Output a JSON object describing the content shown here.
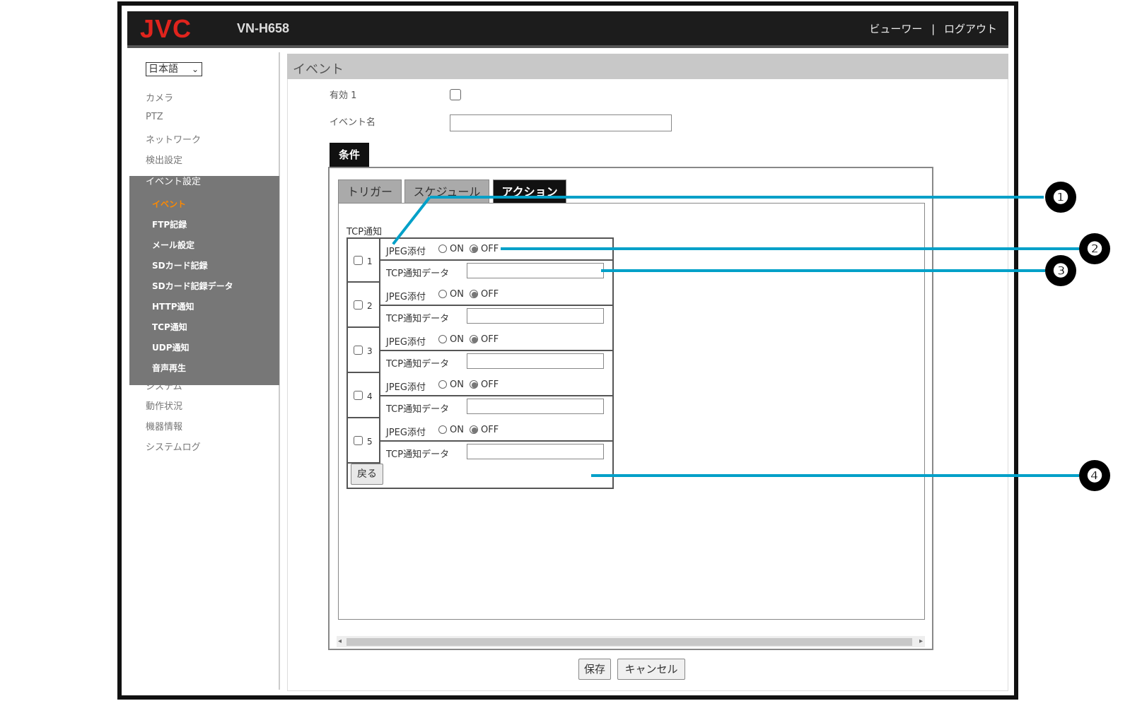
{
  "header": {
    "logo": "JVC",
    "model": "VN-H658",
    "viewer_link": "ビューワー",
    "separator": "|",
    "logout_link": "ログアウト"
  },
  "sidebar": {
    "language": "日本語",
    "items_top": [
      "カメラ",
      "PTZ",
      "ネットワーク",
      "検出設定"
    ],
    "group_title": "イベント設定",
    "sub_items": [
      "イベント",
      "FTP記録",
      "メール設定",
      "SDカード記録",
      "SDカード記録データ",
      "HTTP通知",
      "TCP通知",
      "UDP通知",
      "音声再生"
    ],
    "items_bottom": [
      "システム",
      "動作状況",
      "機器情報",
      "システムログ"
    ]
  },
  "main": {
    "title": "イベント",
    "enable_label": "有効 1",
    "event_name_label": "イベント名",
    "event_name_value": "",
    "tab_condition": "条件",
    "subtabs": [
      "トリガー",
      "スケジュール",
      "アクション"
    ],
    "tcp_label": "TCP通知",
    "rows": [
      {
        "num": "1",
        "jpeg_label": "JPEG添付",
        "on": "ON",
        "off": "OFF",
        "data_label": "TCP通知データ",
        "data_value": ""
      },
      {
        "num": "2",
        "jpeg_label": "JPEG添付",
        "on": "ON",
        "off": "OFF",
        "data_label": "TCP通知データ",
        "data_value": ""
      },
      {
        "num": "3",
        "jpeg_label": "JPEG添付",
        "on": "ON",
        "off": "OFF",
        "data_label": "TCP通知データ",
        "data_value": ""
      },
      {
        "num": "4",
        "jpeg_label": "JPEG添付",
        "on": "ON",
        "off": "OFF",
        "data_label": "TCP通知データ",
        "data_value": ""
      },
      {
        "num": "5",
        "jpeg_label": "JPEG添付",
        "on": "ON",
        "off": "OFF",
        "data_label": "TCP通知データ",
        "data_value": ""
      }
    ],
    "back_button": "戻る",
    "save_button": "保存",
    "cancel_button": "キャンセル"
  },
  "callouts": [
    "❶",
    "❷",
    "❸",
    "❹"
  ],
  "colors": {
    "logo": "#e0241d",
    "active_menu": "#ff8a00",
    "callout_line": "#00a0c8"
  }
}
